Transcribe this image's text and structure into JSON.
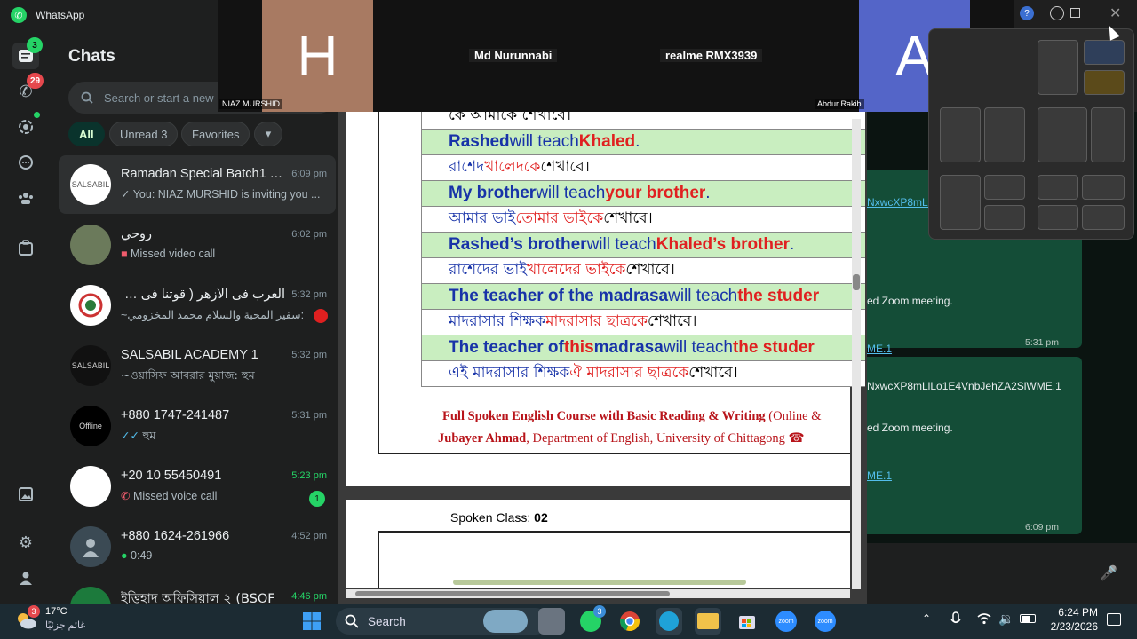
{
  "whatsapp": {
    "app_title": "WhatsApp",
    "rail": {
      "chats_badge": "3",
      "calls_badge": "29"
    },
    "chats_title": "Chats",
    "search_placeholder": "Search or start a new",
    "filters": [
      {
        "label": "All"
      },
      {
        "label": "Unread 3"
      },
      {
        "label": "Favorites"
      }
    ],
    "chats": [
      {
        "name": "Ramadan Special Batch1 b...",
        "preview": "✓ You: NIAZ MURSHID is inviting you ...",
        "time": "6:09 pm",
        "avatar_text": "SALSABIL"
      },
      {
        "name": "روحي",
        "preview": "Missed video call",
        "time": "6:02 pm",
        "avatar_text": ""
      },
      {
        "name": "العرب فى الأزهر ( قوتنا فى وح...",
        "preview": "~سفير المحبة والسلام  محمد المخزومي:",
        "time": "5:32 pm",
        "avatar_text": ""
      },
      {
        "name": "SALSABIL ACADEMY 1",
        "preview": "~ওয়াসিফ আবরার মুয়াজ: হুম",
        "time": "5:32 pm",
        "avatar_text": "SALSABIL"
      },
      {
        "name": "+880 1747-241487",
        "preview": "হুম",
        "time": "5:31 pm",
        "avatar_text": "Offline"
      },
      {
        "name": "+20 10 55450491",
        "preview": "Missed voice call",
        "time": "5:23 pm",
        "avatar_text": "",
        "unread": "1"
      },
      {
        "name": "+880 1624-261966",
        "preview": "0:49",
        "time": "4:52 pm",
        "avatar_text": ""
      },
      {
        "name": "ইত্তিহাদ অফিসিয়াল ২ (BSOF",
        "preview": "",
        "time": "4:46 pm",
        "avatar_text": ""
      }
    ],
    "messages": [
      {
        "link": "NxwcXP8mLlLo",
        "text": "ed Zoom meeting.",
        "short_link": "ME.1",
        "time": "5:31 pm"
      },
      {
        "link": "NxwcXP8mLlLo1E4VnbJehZA2SlWME.1",
        "text": "ed Zoom meeting.",
        "short_link": "ME.1",
        "time": "6:09 pm"
      }
    ]
  },
  "zoom": {
    "tiles": [
      {
        "letter": "H",
        "name": "NIAZ MURSHID",
        "color": "#a87a62"
      },
      {
        "center_name": "Md Nurunnabi"
      },
      {
        "center_name": "realme RMX3939"
      },
      {
        "letter": "A",
        "name": "Abdur Rakib",
        "color": "#5465c8"
      }
    ]
  },
  "document": {
    "rows": [
      {
        "parts": [
          {
            "t": "কে আমাকে শেখাবে।",
            "c": ""
          }
        ],
        "lang": "bn"
      },
      {
        "parts": [
          {
            "t": "Rashed",
            "c": "b"
          },
          {
            "t": " will teach ",
            "c": "k"
          },
          {
            "t": "Khaled",
            "c": "r"
          },
          {
            "t": ".",
            "c": "k"
          }
        ],
        "lang": "en"
      },
      {
        "parts": [
          {
            "t": "রাশেদ",
            "c": "b"
          },
          {
            "t": " খালেদকে",
            "c": "r"
          },
          {
            "t": " শেখাবে।",
            "c": ""
          }
        ],
        "lang": "bn"
      },
      {
        "parts": [
          {
            "t": "My brother",
            "c": "b"
          },
          {
            "t": " will teach ",
            "c": "k"
          },
          {
            "t": "your brother",
            "c": "r"
          },
          {
            "t": ".",
            "c": "k"
          }
        ],
        "lang": "en"
      },
      {
        "parts": [
          {
            "t": "আমার ভাই",
            "c": "b"
          },
          {
            "t": " তোমার ভাইকে",
            "c": "r"
          },
          {
            "t": " শেখাবে।",
            "c": ""
          }
        ],
        "lang": "bn"
      },
      {
        "parts": [
          {
            "t": "Rashed’s brother",
            "c": "b"
          },
          {
            "t": " will teach ",
            "c": "k"
          },
          {
            "t": "Khaled’s brother",
            "c": "r"
          },
          {
            "t": ".",
            "c": "k"
          }
        ],
        "lang": "en"
      },
      {
        "parts": [
          {
            "t": "রাশেদের ভাই",
            "c": "b"
          },
          {
            "t": " খালেদের ভাইকে",
            "c": "r"
          },
          {
            "t": " শেখাবে।",
            "c": ""
          }
        ],
        "lang": "bn"
      },
      {
        "parts": [
          {
            "t": "The teacher of the madrasa",
            "c": "b"
          },
          {
            "t": " will teach ",
            "c": "k"
          },
          {
            "t": "the studer",
            "c": "r"
          }
        ],
        "lang": "en"
      },
      {
        "parts": [
          {
            "t": "মাদরাসার শিক্ষক",
            "c": "b"
          },
          {
            "t": " মাদরাসার ছাত্রকে",
            "c": "r"
          },
          {
            "t": " শেখাবে।",
            "c": ""
          }
        ],
        "lang": "bn"
      },
      {
        "parts": [
          {
            "t": "The teacher of ",
            "c": "b"
          },
          {
            "t": "this",
            "c": "r"
          },
          {
            "t": " madrasa",
            "c": "b"
          },
          {
            "t": " will teach ",
            "c": "k"
          },
          {
            "t": "the studer",
            "c": "r"
          }
        ],
        "lang": "en"
      },
      {
        "parts": [
          {
            "t": "এই মাদরাসার শিক্ষক",
            "c": "b"
          },
          {
            "t": " ঐ মাদরাসার ছাত্রকে",
            "c": "r"
          },
          {
            "t": " শেখাবে।",
            "c": ""
          }
        ],
        "lang": "bn"
      }
    ],
    "footer_line1_a": "Full Spoken English Course with Basic Reading & Writing",
    "footer_line1_b": " (Online &",
    "footer_line2_a": "Jubayer Ahmad",
    "footer_line2_b": ", Department of English, University of Chittagong ☎",
    "page2_label": "Spoken Class: ",
    "page2_number": "02"
  },
  "taskbar": {
    "weather_badge": "3",
    "weather_temp": "17°C",
    "weather_desc": "غائم جزئيًا",
    "search_label": "Search",
    "whatsapp_badge": "3",
    "time": "6:24 PM",
    "date": "2/23/2026"
  },
  "colors": {
    "accent": "#25d366",
    "bubble": "#144d37",
    "doc_blue": "#1833a8",
    "doc_red": "#e02020",
    "row_green": "#c9eec0"
  }
}
